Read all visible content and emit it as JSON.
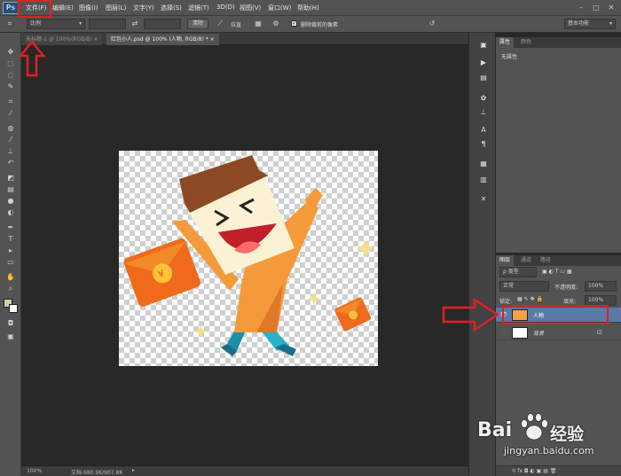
{
  "app": {
    "logo": "Ps"
  },
  "menu": [
    "文件(F)",
    "编辑(E)",
    "图像(I)",
    "图层(L)",
    "文字(Y)",
    "选择(S)",
    "滤镜(T)",
    "3D(D)",
    "视图(V)",
    "窗口(W)",
    "帮助(H)"
  ],
  "window_controls": {
    "minimize": "–",
    "restore": "□",
    "close": "✕"
  },
  "options": {
    "ratio_value": "比例",
    "clear_label": "清除",
    "straighten_label": "拉直",
    "view_label": "视图",
    "delete_cropped_label": "删除裁剪的像素",
    "delete_cropped_checked": true,
    "workspace": "基本功能"
  },
  "tabs": [
    {
      "label": "未标题-1 @ 100%(RGB/8) ×",
      "active": false
    },
    {
      "label": "红包小人.psd @ 100% (人物, RGB/8) * ×",
      "active": true
    }
  ],
  "status": {
    "zoom": "100%",
    "doc": "文档:680.9K/907.8K"
  },
  "properties_panel": {
    "tabs": [
      "属性",
      "颜色"
    ],
    "content": "无属性"
  },
  "layers_panel": {
    "tabs": [
      "图层",
      "通道",
      "路径"
    ],
    "filter_kind": "ρ 类型",
    "blend_mode": "正常",
    "opacity_label": "不透明度:",
    "opacity_value": "100%",
    "lock_label": "锁定:",
    "fill_label": "填充:",
    "fill_value": "100%",
    "layers": [
      {
        "name": "人物",
        "selected": true,
        "visible": true
      },
      {
        "name": "背景",
        "selected": false,
        "visible": false,
        "locked": true
      }
    ]
  },
  "watermark": {
    "brand": "Bai",
    "brand2": "经验",
    "url": "jingyan.baidu.com"
  },
  "colors": {
    "highlight": "#e21f26",
    "selected_layer": "#5a7aa8"
  }
}
